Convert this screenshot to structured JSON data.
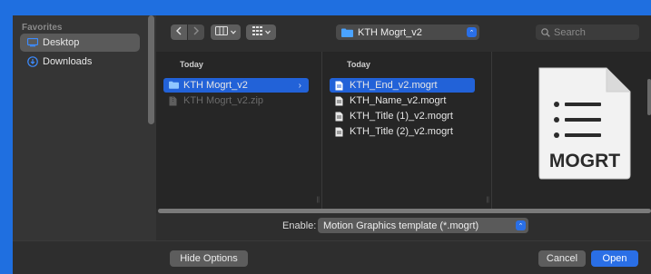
{
  "sidebar": {
    "section_title": "Favorites",
    "items": [
      {
        "label": "Desktop",
        "icon": "desktop-icon",
        "selected": true
      },
      {
        "label": "Downloads",
        "icon": "downloads-icon",
        "selected": false
      }
    ]
  },
  "toolbar": {
    "back_icon": "chevron-left-icon",
    "forward_icon": "chevron-right-icon",
    "view_icon": "column-view-icon",
    "group_icon": "grid-group-icon",
    "location": "KTH Mogrt_v2",
    "search_placeholder": "Search"
  },
  "columns": [
    {
      "header": "Today",
      "items": [
        {
          "label": "KTH Mogrt_v2",
          "type": "folder",
          "selected": true,
          "disabled": false
        },
        {
          "label": "KTH Mogrt_v2.zip",
          "type": "zip",
          "selected": false,
          "disabled": true
        }
      ]
    },
    {
      "header": "Today",
      "items": [
        {
          "label": "KTH_End_v2.mogrt",
          "type": "file",
          "selected": true
        },
        {
          "label": "KTH_Name_v2.mogrt",
          "type": "file",
          "selected": false
        },
        {
          "label": "KTH_Title (1)_v2.mogrt",
          "type": "file",
          "selected": false
        },
        {
          "label": "KTH_Title (2)_v2.mogrt",
          "type": "file",
          "selected": false
        }
      ]
    }
  ],
  "preview": {
    "badge_text": "MOGRT"
  },
  "enable": {
    "label": "Enable:",
    "value": "Motion Graphics template (*.mogrt)"
  },
  "footer": {
    "hide_options": "Hide Options",
    "cancel": "Cancel",
    "open": "Open"
  },
  "colors": {
    "accent": "#2a6fe6",
    "selection": "#2262d8",
    "desktop_bg": "#1f6fe0"
  }
}
